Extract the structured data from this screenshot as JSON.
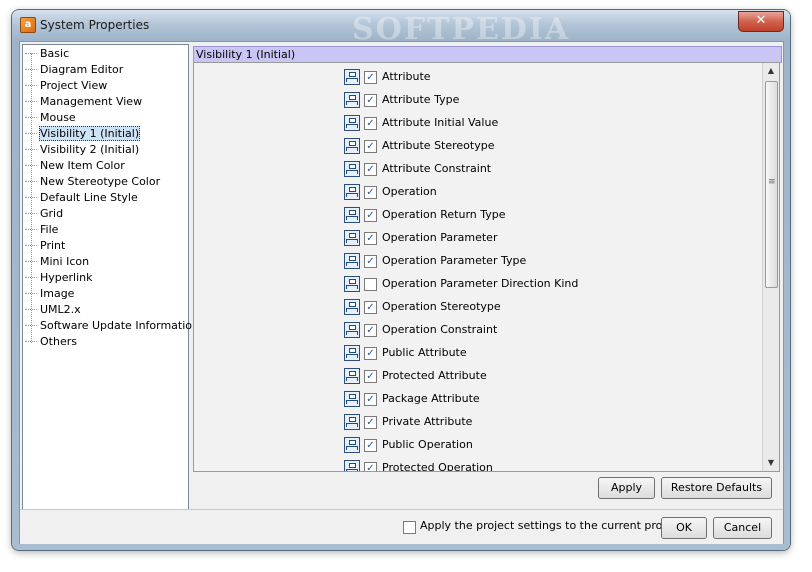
{
  "window": {
    "title": "System Properties",
    "watermark": "SOFTPEDIA",
    "app_icon_glyph": "a",
    "close_glyph": "✕"
  },
  "tree": {
    "items": [
      {
        "label": "Basic",
        "selected": false
      },
      {
        "label": "Diagram Editor",
        "selected": false
      },
      {
        "label": "Project View",
        "selected": false
      },
      {
        "label": "Management View",
        "selected": false
      },
      {
        "label": "Mouse",
        "selected": false
      },
      {
        "label": "Visibility 1 (Initial)",
        "selected": true
      },
      {
        "label": "Visibility 2 (Initial)",
        "selected": false
      },
      {
        "label": "New Item Color",
        "selected": false
      },
      {
        "label": "New Stereotype Color",
        "selected": false
      },
      {
        "label": "Default Line Style",
        "selected": false
      },
      {
        "label": "Grid",
        "selected": false
      },
      {
        "label": "File",
        "selected": false
      },
      {
        "label": "Print",
        "selected": false
      },
      {
        "label": "Mini Icon",
        "selected": false
      },
      {
        "label": "Hyperlink",
        "selected": false
      },
      {
        "label": "Image",
        "selected": false
      },
      {
        "label": "UML2.x",
        "selected": false
      },
      {
        "label": "Software Update Information",
        "selected": false
      },
      {
        "label": "Others",
        "selected": false
      }
    ]
  },
  "panel": {
    "header": "Visibility 1 (Initial)",
    "options": [
      {
        "label": "Attribute",
        "checked": true
      },
      {
        "label": "Attribute Type",
        "checked": true
      },
      {
        "label": "Attribute Initial Value",
        "checked": true
      },
      {
        "label": "Attribute Stereotype",
        "checked": true
      },
      {
        "label": "Attribute Constraint",
        "checked": true
      },
      {
        "label": "Operation",
        "checked": true
      },
      {
        "label": "Operation Return Type",
        "checked": true
      },
      {
        "label": "Operation Parameter",
        "checked": true
      },
      {
        "label": "Operation Parameter Type",
        "checked": true
      },
      {
        "label": "Operation Parameter Direction Kind",
        "checked": false
      },
      {
        "label": "Operation Stereotype",
        "checked": true
      },
      {
        "label": "Operation Constraint",
        "checked": true
      },
      {
        "label": "Public Attribute",
        "checked": true
      },
      {
        "label": "Protected Attribute",
        "checked": true
      },
      {
        "label": "Package Attribute",
        "checked": true
      },
      {
        "label": "Private Attribute",
        "checked": true
      },
      {
        "label": "Public Operation",
        "checked": true
      },
      {
        "label": "Protected Operation",
        "checked": true
      }
    ],
    "scroll_up_glyph": "▲",
    "scroll_down_glyph": "▼"
  },
  "buttons": {
    "apply": "Apply",
    "restore_defaults": "Restore Defaults",
    "ok": "OK",
    "cancel": "Cancel"
  },
  "footer": {
    "apply_project_label": "Apply the project settings to the current project",
    "apply_project_checked": false
  },
  "icons": {
    "option_icon": "class-diagram-icon",
    "app_icon": "visual-paradigm-app-icon"
  }
}
